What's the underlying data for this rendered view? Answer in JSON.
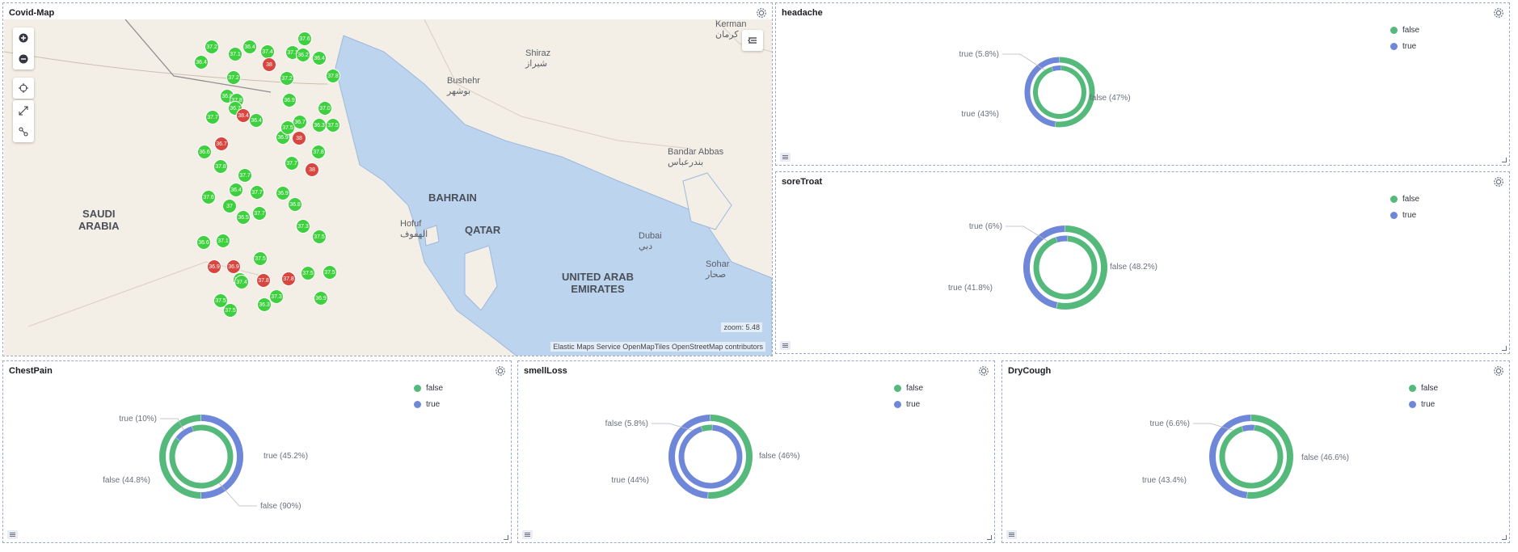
{
  "map_panel": {
    "title": "Covid-Map",
    "zoom_label": "zoom: 5.48",
    "attribution": "Elastic Maps Service OpenMapTiles OpenStreetMap contributors",
    "labels": {
      "saudi": "SAUDI\nARABIA",
      "bahrain": "BAHRAIN",
      "qatar": "QATAR",
      "uae": "UNITED ARAB\nEMIRATES"
    },
    "cities": {
      "kerman": "Kerman\nکرمان",
      "shiraz": "Shiraz\nشیراز",
      "bushehr": "Bushehr\nبوشهر",
      "bandar": "Bandar Abbas\nبندرعباس",
      "hofuf": "Hofuf\nالهفوف",
      "dubai": "Dubai\nدبي",
      "sohar": "Sohar\nصحار"
    },
    "markers": [
      {
        "v": "37.2",
        "c": "g"
      },
      {
        "v": "37.1",
        "c": "g"
      },
      {
        "v": "36.4",
        "c": "g"
      },
      {
        "v": "37.4",
        "c": "g"
      },
      {
        "v": "37.6",
        "c": "g"
      },
      {
        "v": "36.4",
        "c": "g"
      },
      {
        "v": "37.1",
        "c": "g"
      },
      {
        "v": "38",
        "c": "r"
      },
      {
        "v": "36.2",
        "c": "g"
      },
      {
        "v": "36.4",
        "c": "g"
      },
      {
        "v": "37.2",
        "c": "g"
      },
      {
        "v": "37.2",
        "c": "g"
      },
      {
        "v": "37.8",
        "c": "g"
      },
      {
        "v": "36.8",
        "c": "g"
      },
      {
        "v": "37.8",
        "c": "g"
      },
      {
        "v": "36.7",
        "c": "g"
      },
      {
        "v": "38.4",
        "c": "r"
      },
      {
        "v": "36.9",
        "c": "g"
      },
      {
        "v": "37.0",
        "c": "g"
      },
      {
        "v": "37.7",
        "c": "g"
      },
      {
        "v": "36.4",
        "c": "g"
      },
      {
        "v": "36.3",
        "c": "g"
      },
      {
        "v": "36.7",
        "c": "g"
      },
      {
        "v": "38",
        "c": "r"
      },
      {
        "v": "37.5",
        "c": "g"
      },
      {
        "v": "36.7",
        "c": "r"
      },
      {
        "v": "36.9",
        "c": "g"
      },
      {
        "v": "37.5",
        "c": "g"
      },
      {
        "v": "37.8",
        "c": "g"
      },
      {
        "v": "36.6",
        "c": "g"
      },
      {
        "v": "37.7",
        "c": "g"
      },
      {
        "v": "38",
        "c": "r"
      },
      {
        "v": "37.8",
        "c": "g"
      },
      {
        "v": "36.4",
        "c": "g"
      },
      {
        "v": "37.7",
        "c": "g"
      },
      {
        "v": "36.9",
        "c": "g"
      },
      {
        "v": "36.8",
        "c": "g"
      },
      {
        "v": "37",
        "c": "g"
      },
      {
        "v": "37.7",
        "c": "g"
      },
      {
        "v": "36.5",
        "c": "g"
      },
      {
        "v": "37.7",
        "c": "g"
      },
      {
        "v": "37.6",
        "c": "g"
      },
      {
        "v": "36.6",
        "c": "g"
      },
      {
        "v": "37.1",
        "c": "g"
      },
      {
        "v": "37.3",
        "c": "g"
      },
      {
        "v": "37.5",
        "c": "g"
      },
      {
        "v": "36.9",
        "c": "r"
      },
      {
        "v": "37.5",
        "c": "g"
      },
      {
        "v": "37.5",
        "c": "g"
      },
      {
        "v": "37.4",
        "c": "g"
      },
      {
        "v": "37.8",
        "c": "r"
      },
      {
        "v": "36.9",
        "c": "r"
      },
      {
        "v": "37.4",
        "c": "g"
      },
      {
        "v": "37.8",
        "c": "r"
      },
      {
        "v": "37.5",
        "c": "g"
      },
      {
        "v": "37.3",
        "c": "g"
      },
      {
        "v": "36.3",
        "c": "g"
      },
      {
        "v": "37.5",
        "c": "g"
      },
      {
        "v": "36.9",
        "c": "g"
      },
      {
        "v": "37.5",
        "c": "g"
      }
    ]
  },
  "pies": [
    {
      "id": "headache",
      "title": "headache",
      "legend": [
        "false",
        "true"
      ],
      "outer": [
        {
          "label": "false (47%)",
          "value": 47,
          "color": "green"
        },
        {
          "label": "true (43%)",
          "value": 43,
          "color": "blue"
        }
      ],
      "inner": [
        {
          "label": "true (5.8%)",
          "value": 5.8,
          "color": "blue"
        }
      ]
    },
    {
      "id": "soretroat",
      "title": "soreTroat",
      "legend": [
        "false",
        "true"
      ],
      "outer": [
        {
          "label": "false (48.2%)",
          "value": 48.2,
          "color": "green"
        },
        {
          "label": "true (41.8%)",
          "value": 41.8,
          "color": "blue"
        }
      ],
      "inner": [
        {
          "label": "true (6%)",
          "value": 6,
          "color": "blue"
        }
      ]
    },
    {
      "id": "chestpain",
      "title": "ChestPain",
      "legend": [
        "false",
        "true"
      ],
      "outer": [
        {
          "label": "true (45.2%)",
          "value": 45.2,
          "color": "blue"
        },
        {
          "label": "false (44.8%)",
          "value": 44.8,
          "color": "green"
        }
      ],
      "inner": [
        {
          "label": "false (90%)",
          "value": 90,
          "color": "green"
        },
        {
          "label": "true (10%)",
          "value": 10,
          "color": "blue"
        }
      ]
    },
    {
      "id": "smellloss",
      "title": "smellLoss",
      "legend": [
        "false",
        "true"
      ],
      "outer": [
        {
          "label": "false (46%)",
          "value": 46,
          "color": "green"
        },
        {
          "label": "true (44%)",
          "value": 44,
          "color": "blue"
        }
      ],
      "inner": [
        {
          "label": "false (5.8%)",
          "value": 5.8,
          "color": "green"
        }
      ]
    },
    {
      "id": "drycough",
      "title": "DryCough",
      "legend": [
        "false",
        "true"
      ],
      "outer": [
        {
          "label": "false (46.6%)",
          "value": 46.6,
          "color": "green"
        },
        {
          "label": "true (43.4%)",
          "value": 43.4,
          "color": "blue"
        }
      ],
      "inner": [
        {
          "label": "true (6.6%)",
          "value": 6.6,
          "color": "blue"
        }
      ]
    }
  ],
  "colors": {
    "green": "#54b97a",
    "blue": "#6f87d8",
    "marker_green": "#3fd03f",
    "marker_red": "#d9463f",
    "water": "#bcd4ee"
  }
}
